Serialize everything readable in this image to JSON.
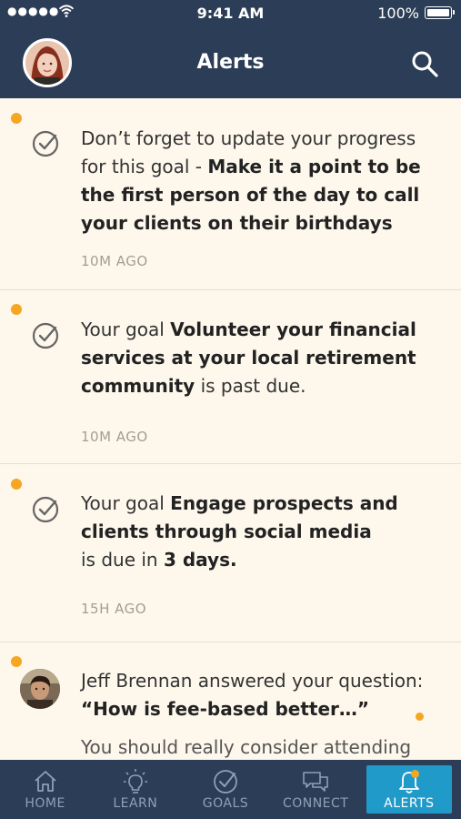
{
  "status": {
    "signal": "●●●●●",
    "time": "9:41 AM",
    "battery": "100%"
  },
  "header": {
    "title": "Alerts"
  },
  "alerts": [
    {
      "parts": [
        {
          "text": "Don’t forget to update your progress for this goal - ",
          "bold": false
        },
        {
          "text": "Make it a point to be the first person of the day to call your clients on their birthdays",
          "bold": true
        }
      ],
      "time": "10M AGO"
    },
    {
      "parts": [
        {
          "text": "Your goal ",
          "bold": false
        },
        {
          "text": "Volunteer your financial services at your local retirement community",
          "bold": true
        },
        {
          "text": " is past due.",
          "bold": false
        }
      ],
      "time": "10M AGO"
    },
    {
      "parts": [
        {
          "text": "Your goal ",
          "bold": false
        },
        {
          "text": "Engage prospects and clients through social media",
          "bold": true
        },
        {
          "text": " is due in ",
          "bold": false
        },
        {
          "text": "3 days.",
          "bold": true
        }
      ],
      "time": "15H AGO"
    },
    {
      "line1": "Jeff Brennan answered your question:",
      "quote": "“How is fee-based better…”",
      "line3": "You should really consider attending"
    }
  ],
  "tabs": [
    {
      "label": "HOME",
      "icon": "home-icon"
    },
    {
      "label": "LEARN",
      "icon": "lightbulb-icon"
    },
    {
      "label": "GOALS",
      "icon": "check-circle-icon"
    },
    {
      "label": "CONNECT",
      "icon": "chat-icon"
    },
    {
      "label": "ALERTS",
      "icon": "bell-icon"
    }
  ],
  "colors": {
    "header": "#2c3e57",
    "accent": "#f5a623",
    "active_tab": "#1f9ac9",
    "background": "#fdf7ec"
  }
}
